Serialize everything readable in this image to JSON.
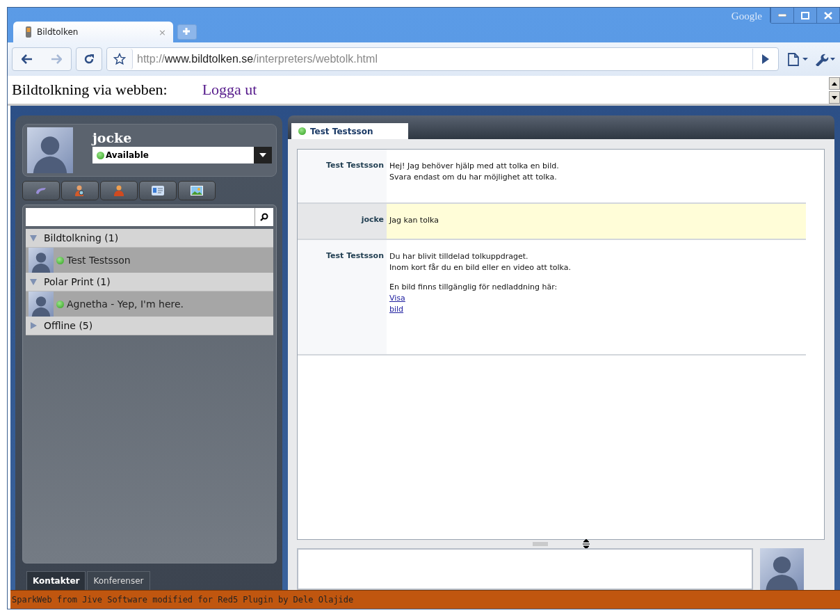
{
  "browser": {
    "brand": "Google",
    "tabs": [
      {
        "title": "Bildtolken",
        "close": "×",
        "selected": true
      }
    ],
    "url": {
      "scheme": "http://",
      "host": "www.bildtolken.se",
      "path": "/interpreters/webtolk.html"
    }
  },
  "page": {
    "heading": "Bildtolkning via webben:",
    "logout_link": "Logga ut"
  },
  "profile": {
    "name": "jocke",
    "status": "Available",
    "online": true
  },
  "roster": {
    "groups": [
      {
        "name": "Bildtolkning (1)",
        "expanded": true,
        "contacts": [
          {
            "name": "Test Testsson",
            "online": true
          }
        ]
      },
      {
        "name": "Polar Print (1)",
        "expanded": true,
        "contacts": [
          {
            "name": "Agnetha - Yep, I'm here.",
            "online": true
          }
        ]
      },
      {
        "name": "Offline (5)",
        "expanded": false
      }
    ]
  },
  "bottom_tabs": [
    {
      "label": "Kontakter",
      "selected": true
    },
    {
      "label": "Konferenser",
      "selected": false
    }
  ],
  "chat": {
    "tabs": [
      {
        "label": "Test Testsson",
        "online": true,
        "selected": true
      }
    ],
    "messages": [
      {
        "sender": "Test Testsson",
        "own": false,
        "paragraphs": [
          "Hej! Jag behöver hjälp med att tolka en bild.\nSvara endast om du har möjlighet att tolka."
        ]
      },
      {
        "sender": "jocke",
        "own": true,
        "paragraphs": [
          "Jag kan tolka"
        ]
      },
      {
        "sender": "Test Testsson",
        "own": false,
        "paragraphs": [
          "Du har blivit tilldelad tolkuppdraget.\nInom kort får du en bild eller en video att tolka.",
          "En bild finns tillgänglig för nedladdning här:"
        ],
        "link": "Visa bild"
      }
    ]
  },
  "footer": "SparkWeb from Jive Software modified for Red5 Plugin by Dele Olajide"
}
